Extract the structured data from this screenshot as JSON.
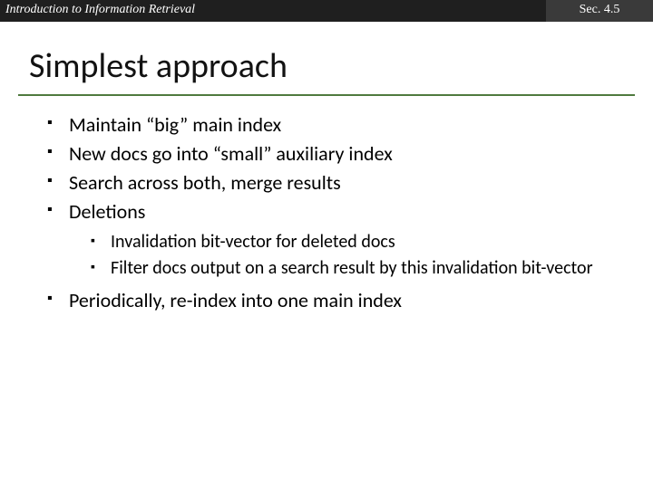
{
  "header": {
    "left": "Introduction to Information Retrieval",
    "right": "Sec. 4.5"
  },
  "title": "Simplest approach",
  "bullets": [
    {
      "text": "Maintain “big” main index"
    },
    {
      "text": "New docs go into “small” auxiliary index"
    },
    {
      "text": "Search across both, merge results"
    },
    {
      "text": "Deletions",
      "children": [
        "Invalidation bit-vector for deleted docs",
        "Filter docs output on a search result by this invalidation bit-vector"
      ]
    },
    {
      "text": "Periodically, re-index into one main index"
    }
  ]
}
